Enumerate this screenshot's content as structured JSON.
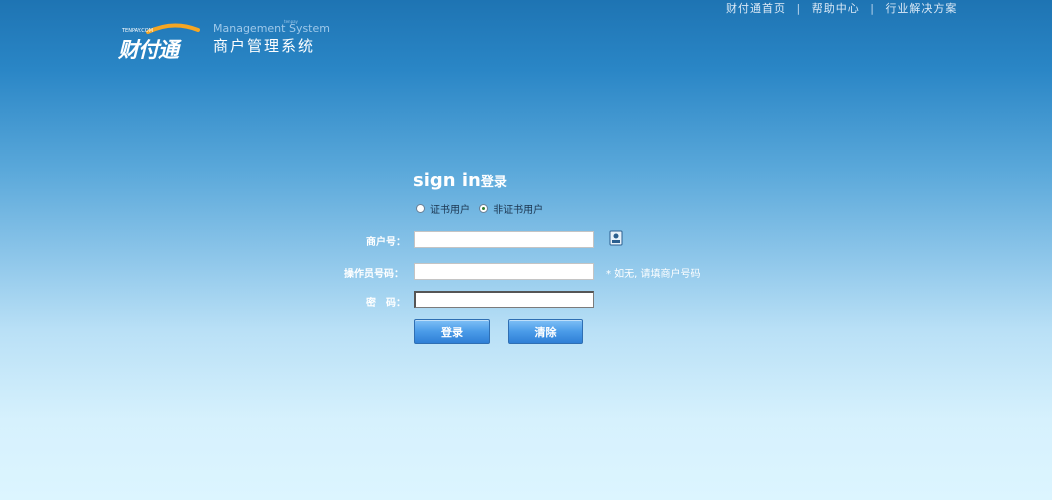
{
  "topnav": {
    "links": [
      "财付通首页",
      "帮助中心",
      "行业解决方案"
    ],
    "separator": "|"
  },
  "logo": {
    "brand": "财付通",
    "brand_small": "TENPAY.COM",
    "english": "Management System",
    "tiny": "tenpay",
    "chinese": "商户管理系统"
  },
  "form": {
    "title_en": "sign in",
    "title_cn": "登录",
    "radios": [
      {
        "label": "证书用户",
        "checked": false
      },
      {
        "label": "非证书用户",
        "checked": true
      }
    ],
    "merchant_label": "商户号：",
    "operator_label": "操作员号码：",
    "password_label": "密　码：",
    "merchant_value": "",
    "operator_value": "",
    "password_value": "",
    "operator_hint": "* 如无, 请填商户号码",
    "login_button": "登录",
    "clear_button": "清除"
  },
  "colors": {
    "bg_top": "#1e74b3",
    "bg_bottom": "#dcf5ff",
    "button": "#4a9be8"
  },
  "icons": {
    "cert": "certificate-user-icon"
  }
}
